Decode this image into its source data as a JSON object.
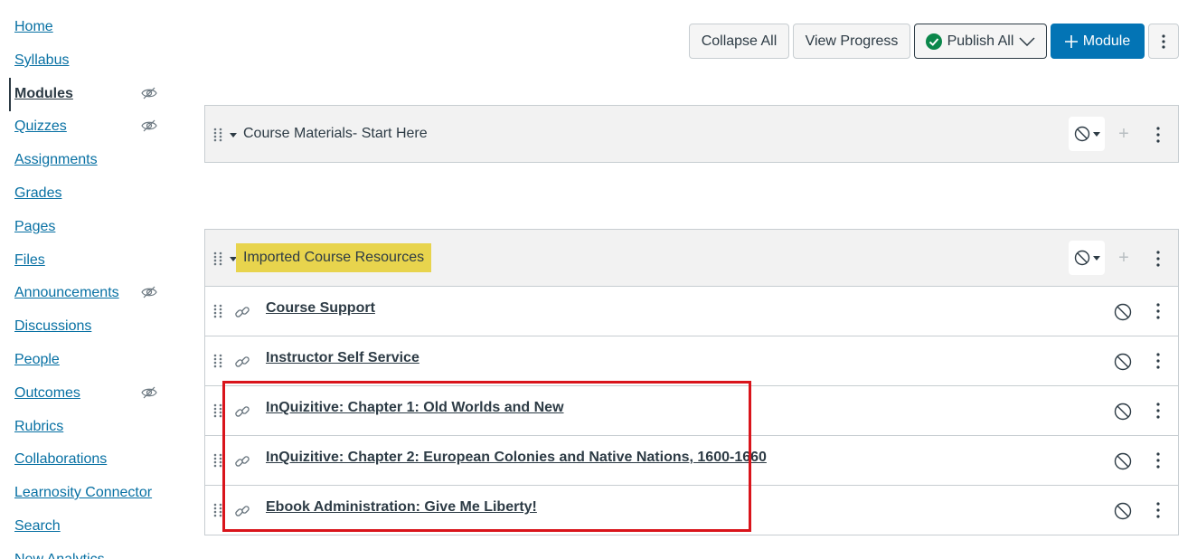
{
  "nav": {
    "items": [
      {
        "label": "Home"
      },
      {
        "label": "Syllabus"
      },
      {
        "label": "Modules"
      },
      {
        "label": "Quizzes"
      },
      {
        "label": "Assignments"
      },
      {
        "label": "Grades"
      },
      {
        "label": "Pages"
      },
      {
        "label": "Files"
      },
      {
        "label": "Announcements"
      },
      {
        "label": "Discussions"
      },
      {
        "label": "People"
      },
      {
        "label": "Outcomes"
      },
      {
        "label": "Rubrics"
      },
      {
        "label": "Collaborations"
      },
      {
        "label": "Learnosity Connector"
      },
      {
        "label": "Search"
      },
      {
        "label": "New Analytics"
      }
    ],
    "active": "Modules",
    "hidden_icon_items": [
      "Modules",
      "Quizzes",
      "Announcements",
      "Outcomes"
    ]
  },
  "toolbar": {
    "collapse_all": "Collapse All",
    "view_progress": "View Progress",
    "publish_all": "Publish All",
    "add_module": "Module"
  },
  "modules": [
    {
      "title": "Course Materials- Start Here",
      "items": []
    },
    {
      "title": "Imported Course Resources",
      "items": [
        {
          "title": "Course Support"
        },
        {
          "title": "Instructor Self Service"
        },
        {
          "title": "InQuizitive: Chapter 1: Old Worlds and New"
        },
        {
          "title": "InQuizitive: Chapter 2: European Colonies and Native Nations, 1600-1660"
        },
        {
          "title": "Ebook Administration: Give Me Liberty!"
        }
      ]
    }
  ],
  "colors": {
    "link": "#0770a3",
    "primary": "#0374b5",
    "highlight": "#e8d44d",
    "annotation_box": "#d9141b",
    "publish_check": "#0b874b"
  },
  "icons": {
    "hidden": "eye-slash-icon",
    "drag": "drag-handle-icon",
    "link": "link-icon",
    "unpublished": "unpublished-icon",
    "more": "kebab-icon"
  }
}
